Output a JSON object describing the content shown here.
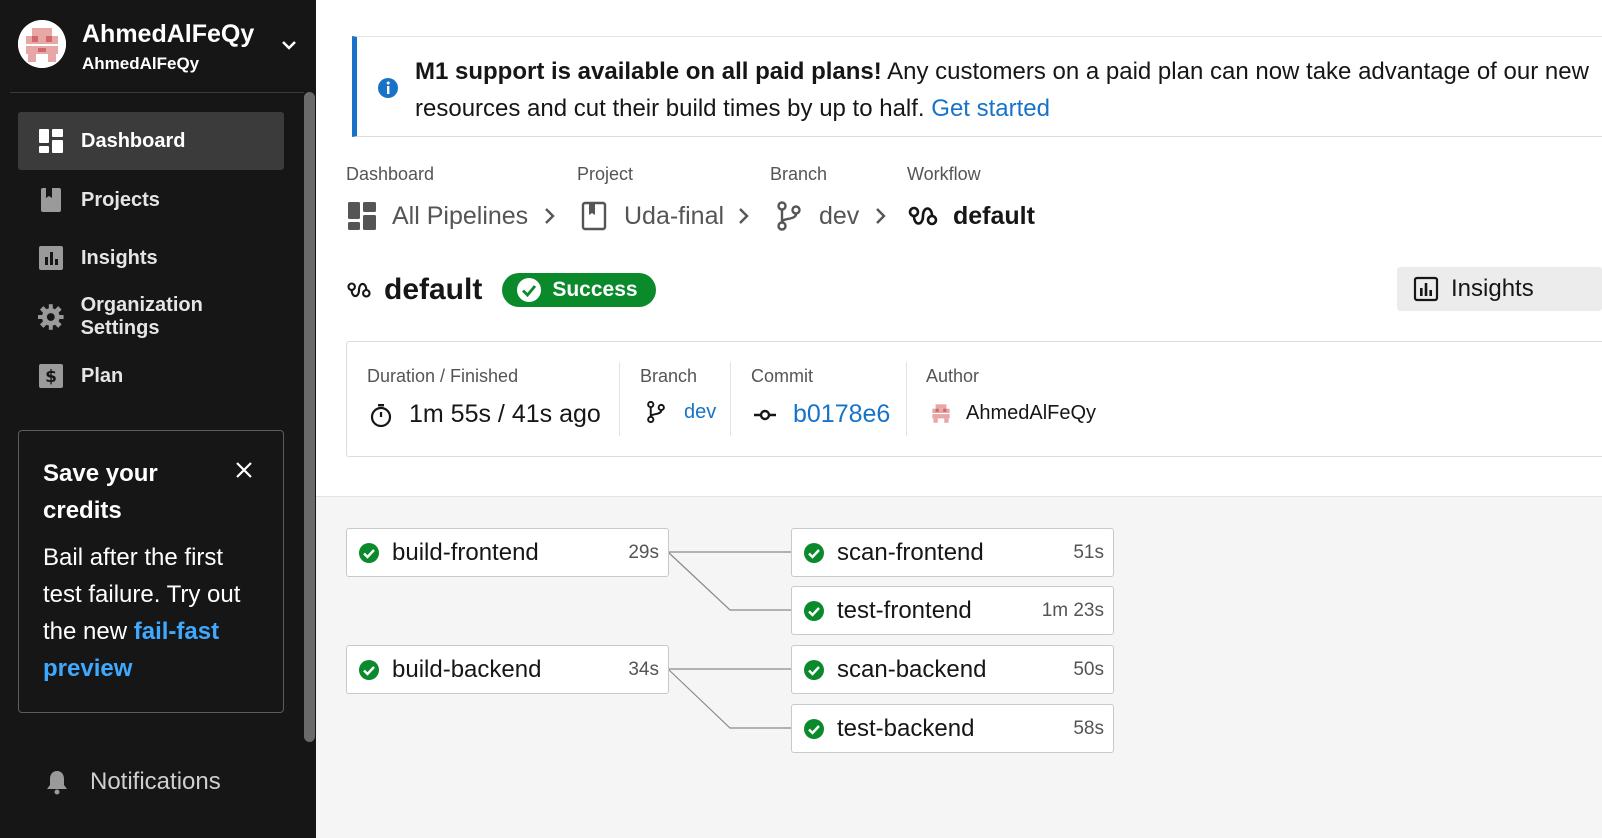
{
  "sidebar": {
    "org_name": "AhmedAlFeQy",
    "org_sub": "AhmedAlFeQy",
    "nav": [
      {
        "label": "Dashboard",
        "icon": "dashboard-icon",
        "active": true
      },
      {
        "label": "Projects",
        "icon": "projects-icon",
        "active": false
      },
      {
        "label": "Insights",
        "icon": "insights-icon",
        "active": false
      },
      {
        "label": "Organization Settings",
        "icon": "gear-icon",
        "active": false
      },
      {
        "label": "Plan",
        "icon": "dollar-icon",
        "active": false
      }
    ],
    "promo": {
      "title": "Save your credits",
      "body": "Bail after the first test failure. Try out the new ",
      "link": "fail-fast preview"
    },
    "notifications_label": "Notifications"
  },
  "banner": {
    "bold": "M1 support is available on all paid plans!",
    "text": " Any customers on a paid plan can now take advantage of our new",
    "text2": "resources and cut their build times by up to half. ",
    "link": "Get started"
  },
  "breadcrumb": {
    "labels": [
      "Dashboard",
      "Project",
      "Branch",
      "Workflow"
    ],
    "items": [
      "All Pipelines",
      "Uda-final",
      "dev",
      "default"
    ]
  },
  "workflow": {
    "title": "default",
    "status": "Success",
    "insights_label": "Insights"
  },
  "info": {
    "duration_label": "Duration / Finished",
    "duration_value": "1m 55s / 41s ago",
    "branch_label": "Branch",
    "branch_value": "dev",
    "commit_label": "Commit",
    "commit_value": "b0178e6",
    "author_label": "Author",
    "author_value": "AhmedAlFeQy"
  },
  "jobs": [
    {
      "name": "build-frontend",
      "duration": "29s"
    },
    {
      "name": "scan-frontend",
      "duration": "51s"
    },
    {
      "name": "test-frontend",
      "duration": "1m 23s"
    },
    {
      "name": "build-backend",
      "duration": "34s"
    },
    {
      "name": "scan-backend",
      "duration": "50s"
    },
    {
      "name": "test-backend",
      "duration": "58s"
    }
  ],
  "colors": {
    "sidebar_bg": "#161616",
    "success": "#0b8a2c",
    "link": "#1873c8",
    "promo_link": "#3fa9ff"
  }
}
